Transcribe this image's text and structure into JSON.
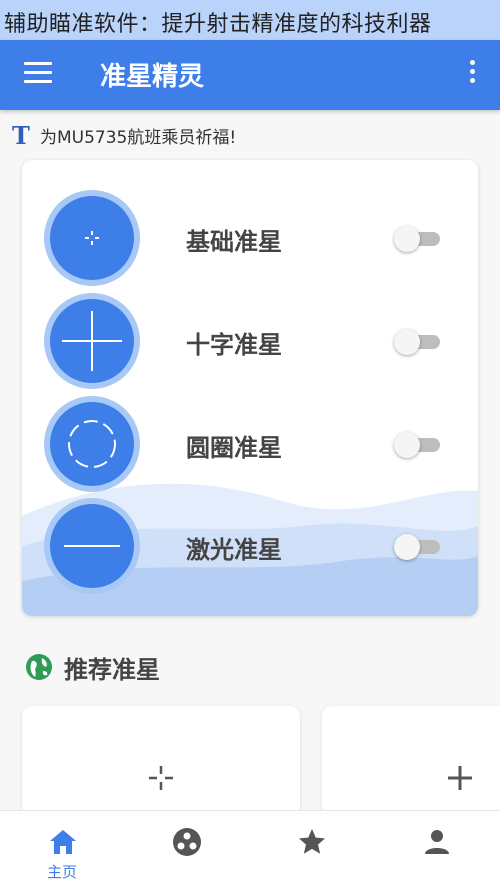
{
  "caption": "辅助瞄准软件：提升射击精准度的科技利器",
  "appbar": {
    "title": "准星精灵",
    "menu_icon": "menu-icon",
    "more_icon": "more-vertical-icon",
    "color": "#3d7ee9"
  },
  "notice": {
    "icon": "t-letter-icon",
    "text": "为MU5735航班乘员祈福!"
  },
  "crosshairs": [
    {
      "label": "基础准星",
      "icon": "small-cross-icon",
      "enabled": false
    },
    {
      "label": "十字准星",
      "icon": "cross-icon",
      "enabled": false
    },
    {
      "label": "圆圈准星",
      "icon": "dashed-circle-icon",
      "enabled": false
    },
    {
      "label": "激光准星",
      "icon": "line-icon",
      "enabled": false
    }
  ],
  "recommended": {
    "title": "推荐准星",
    "icon": "globe-icon",
    "items": [
      {
        "icon": "dotted-cross-icon"
      },
      {
        "icon": "plus-icon"
      }
    ]
  },
  "bottom_nav": {
    "items": [
      {
        "icon": "home-icon",
        "label": "主页",
        "active": true
      },
      {
        "icon": "community-icon",
        "label": "",
        "active": false
      },
      {
        "icon": "star-icon",
        "label": "",
        "active": false
      },
      {
        "icon": "person-icon",
        "label": "",
        "active": false
      }
    ]
  }
}
